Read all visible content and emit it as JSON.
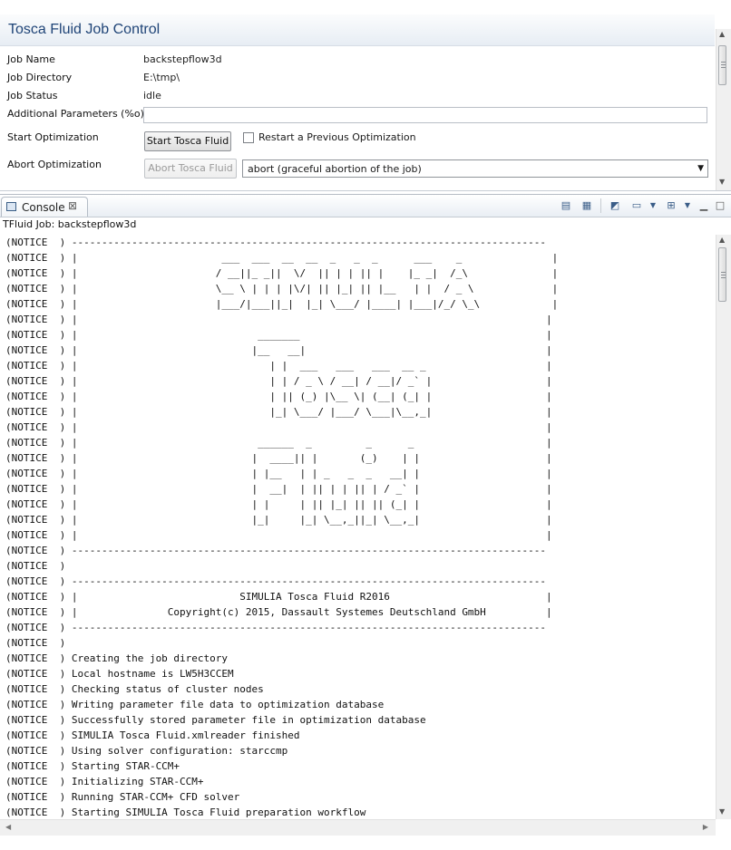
{
  "job_control": {
    "title": "Tosca Fluid Job Control",
    "job_name_label": "Job Name",
    "job_name_value": "backstepflow3d",
    "job_dir_label": "Job Directory",
    "job_dir_value": "E:\\tmp\\",
    "job_status_label": "Job Status",
    "job_status_value": "idle",
    "params_label": "Additional Parameters (%o)",
    "params_value": "",
    "start_label": "Start Optimization",
    "start_button": "Start Tosca Fluid",
    "restart_label": "Restart a Previous Optimization",
    "abort_label": "Abort Optimization",
    "abort_button": "Abort Tosca Fluid",
    "abort_option": "abort (graceful abortion of the job)"
  },
  "console": {
    "tab_label": "Console",
    "tab_close": "⊠",
    "job_line": "TFluid Job: backstepflow3d",
    "toolbar_icons": [
      "clear-console-icon",
      "scroll-lock-icon",
      "pin-console-icon",
      "display-console-icon",
      "open-console-icon",
      "minimize-icon",
      "maximize-icon"
    ],
    "lines": [
      "(NOTICE  ) -------------------------------------------------------------------------------",
      "(NOTICE  ) |                        ___  ___  __  __  _   _  _      ___    _               |",
      "(NOTICE  ) |                       / __||_ _||  \\/  || | | || |    |_ _|  /_\\              |",
      "(NOTICE  ) |                       \\__ \\ | | | |\\/| || |_| || |__   | |  / _ \\             |",
      "(NOTICE  ) |                       |___/|___||_|  |_| \\___/ |____| |___|/_/ \\_\\            |",
      "(NOTICE  ) |                                                                              |",
      "(NOTICE  ) |                              _______                                         |",
      "(NOTICE  ) |                             |__   __|                                        |",
      "(NOTICE  ) |                                | |  ___   ___   ___  __ _                    |",
      "(NOTICE  ) |                                | | / _ \\ / __| / __|/ _` |                   |",
      "(NOTICE  ) |                                | || (_) |\\__ \\| (__| (_| |                   |",
      "(NOTICE  ) |                                |_| \\___/ |___/ \\___|\\__,_|                   |",
      "(NOTICE  ) |                                                                              |",
      "(NOTICE  ) |                              ______  _         _      _                      |",
      "(NOTICE  ) |                             |  ____|| |       (_)    | |                     |",
      "(NOTICE  ) |                             | |__   | | _   _  _   __| |                     |",
      "(NOTICE  ) |                             |  __|  | || | | || | / _` |                     |",
      "(NOTICE  ) |                             | |     | || |_| || || (_| |                     |",
      "(NOTICE  ) |                             |_|     |_| \\__,_||_| \\__,_|                     |",
      "(NOTICE  ) |                                                                              |",
      "(NOTICE  ) -------------------------------------------------------------------------------",
      "(NOTICE  )",
      "(NOTICE  ) -------------------------------------------------------------------------------",
      "(NOTICE  ) |                           SIMULIA Tosca Fluid R2016                          |",
      "(NOTICE  ) |               Copyright(c) 2015, Dassault Systemes Deutschland GmbH          |",
      "(NOTICE  ) -------------------------------------------------------------------------------",
      "(NOTICE  )",
      "(NOTICE  ) Creating the job directory",
      "(NOTICE  ) Local hostname is LW5H3CCEM",
      "(NOTICE  ) Checking status of cluster nodes",
      "(NOTICE  ) Writing parameter file data to optimization database",
      "(NOTICE  ) Successfully stored parameter file in optimization database",
      "(NOTICE  ) SIMULIA Tosca Fluid.xmlreader finished",
      "(NOTICE  ) Using solver configuration: starccmp",
      "(NOTICE  ) Starting STAR-CCM+",
      "(NOTICE  ) Initializing STAR-CCM+",
      "(NOTICE  ) Running STAR-CCM+ CFD solver",
      "(NOTICE  ) Starting SIMULIA Tosca Fluid preparation workflow"
    ]
  }
}
